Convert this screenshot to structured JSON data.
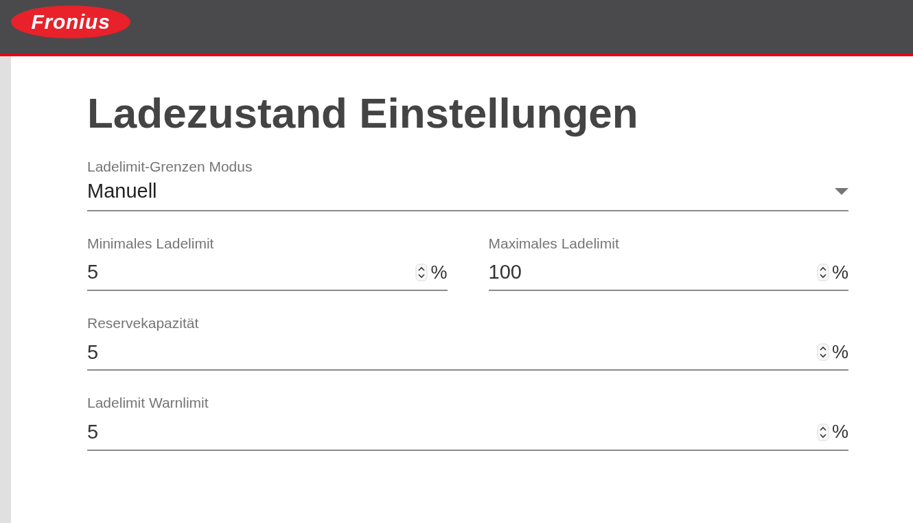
{
  "header": {
    "logo": "Fronius"
  },
  "page": {
    "title": "Ladezustand Einstellungen"
  },
  "rows": [
    [
      {
        "kind": "select",
        "label": "Ladelimit-Grenzen Modus",
        "value": "Manuell"
      }
    ],
    [
      {
        "kind": "number",
        "label": "Minimales Ladelimit",
        "value": "5",
        "unit": "%"
      },
      {
        "kind": "number",
        "label": "Maximales Ladelimit",
        "value": "100",
        "unit": "%"
      }
    ],
    [
      {
        "kind": "number",
        "label": "Reservekapazität",
        "value": "5",
        "unit": "%"
      }
    ],
    [
      {
        "kind": "number",
        "label": "Ladelimit Warnlimit",
        "value": "5",
        "unit": "%"
      }
    ]
  ]
}
